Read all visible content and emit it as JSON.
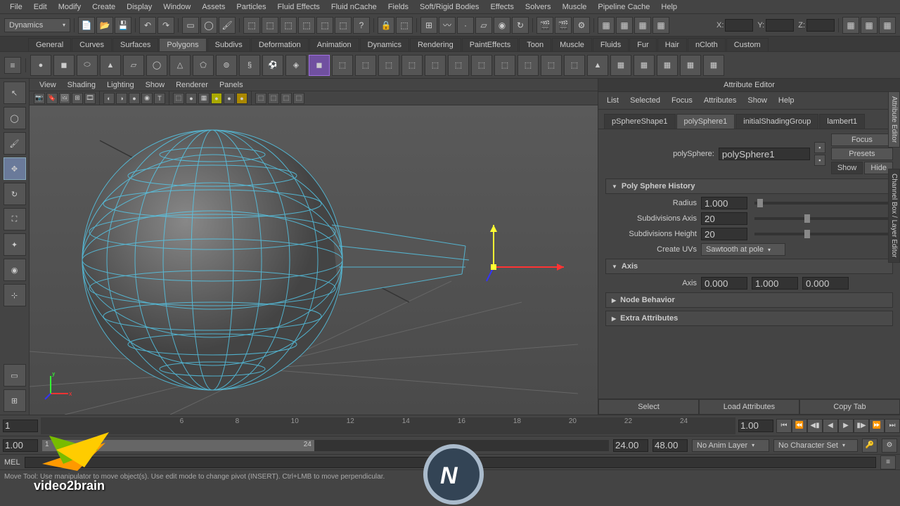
{
  "menubar": [
    "File",
    "Edit",
    "Modify",
    "Create",
    "Display",
    "Window",
    "Assets",
    "Particles",
    "Fluid Effects",
    "Fluid nCache",
    "Fields",
    "Soft/Rigid Bodies",
    "Effects",
    "Solvers",
    "Muscle",
    "Pipeline Cache",
    "Help"
  ],
  "mode_dropdown": "Dynamics",
  "coords": {
    "x_label": "X:",
    "y_label": "Y:",
    "z_label": "Z:",
    "x": "",
    "y": "",
    "z": ""
  },
  "shelf_tabs": [
    "General",
    "Curves",
    "Surfaces",
    "Polygons",
    "Subdivs",
    "Deformation",
    "Animation",
    "Dynamics",
    "Rendering",
    "PaintEffects",
    "Toon",
    "Muscle",
    "Fluids",
    "Fur",
    "Hair",
    "nCloth",
    "Custom"
  ],
  "shelf_active": "Polygons",
  "viewport_menu": [
    "View",
    "Shading",
    "Lighting",
    "Show",
    "Renderer",
    "Panels"
  ],
  "attr_editor": {
    "title": "Attribute Editor",
    "menu": [
      "List",
      "Selected",
      "Focus",
      "Attributes",
      "Show",
      "Help"
    ],
    "tabs": [
      "pSphereShape1",
      "polySphere1",
      "initialShadingGroup",
      "lambert1"
    ],
    "active_tab": "polySphere1",
    "node_label": "polySphere:",
    "node_value": "polySphere1",
    "side_btns": [
      "Focus",
      "Presets",
      "Show",
      "Hide"
    ],
    "sections": {
      "history": "Poly Sphere History",
      "radius_label": "Radius",
      "radius": "1.000",
      "subaxis_label": "Subdivisions Axis",
      "subaxis": "20",
      "subheight_label": "Subdivisions Height",
      "subheight": "20",
      "createuv_label": "Create UVs",
      "createuv": "Sawtooth at pole",
      "axis_header": "Axis",
      "axis_label": "Axis",
      "axis_x": "0.000",
      "axis_y": "1.000",
      "axis_z": "0.000",
      "behavior": "Node Behavior",
      "extra": "Extra Attributes"
    },
    "footer": [
      "Select",
      "Load Attributes",
      "Copy Tab"
    ]
  },
  "side_tabs": {
    "ae": "Attribute Editor",
    "cb": "Channel Box / Layer Editor"
  },
  "timeline": {
    "ticks": [
      "6",
      "8",
      "10",
      "12",
      "14",
      "16",
      "18",
      "20",
      "22",
      "24"
    ],
    "current_left": "1",
    "current_right": "1.00",
    "range_start": "1.00",
    "range_inner_start": "1",
    "range_inner_end": "24",
    "range_end_a": "24.00",
    "range_end_b": "48.00",
    "anim_layer": "No Anim Layer",
    "char_set": "No Character Set"
  },
  "cmd": {
    "label": "MEL"
  },
  "statusbar": "Move Tool: Use manipulator to move object(s). Use edit mode to change pivot (INSERT). Ctrl+LMB to move perpendicular.",
  "watermark": "video2brain"
}
